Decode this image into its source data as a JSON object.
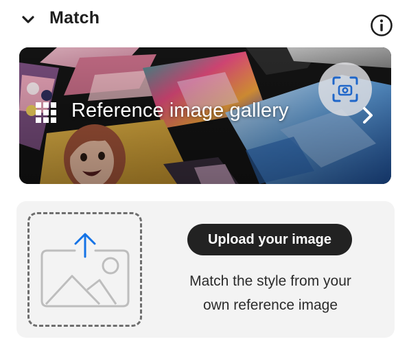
{
  "header": {
    "title": "Match",
    "collapse_icon": "chevron-down-icon",
    "info_icon": "info-icon"
  },
  "gallery": {
    "label": "Reference image gallery",
    "grid_icon": "grid-icon",
    "nav_icon": "chevron-right-icon",
    "visual_search_icon": "visual-search-icon"
  },
  "upload": {
    "button_label": "Upload your image",
    "description_line1": "Match the style from your",
    "description_line2": "own reference image",
    "dropzone_icon": "image-upload-icon",
    "accent": "#1473e6"
  }
}
